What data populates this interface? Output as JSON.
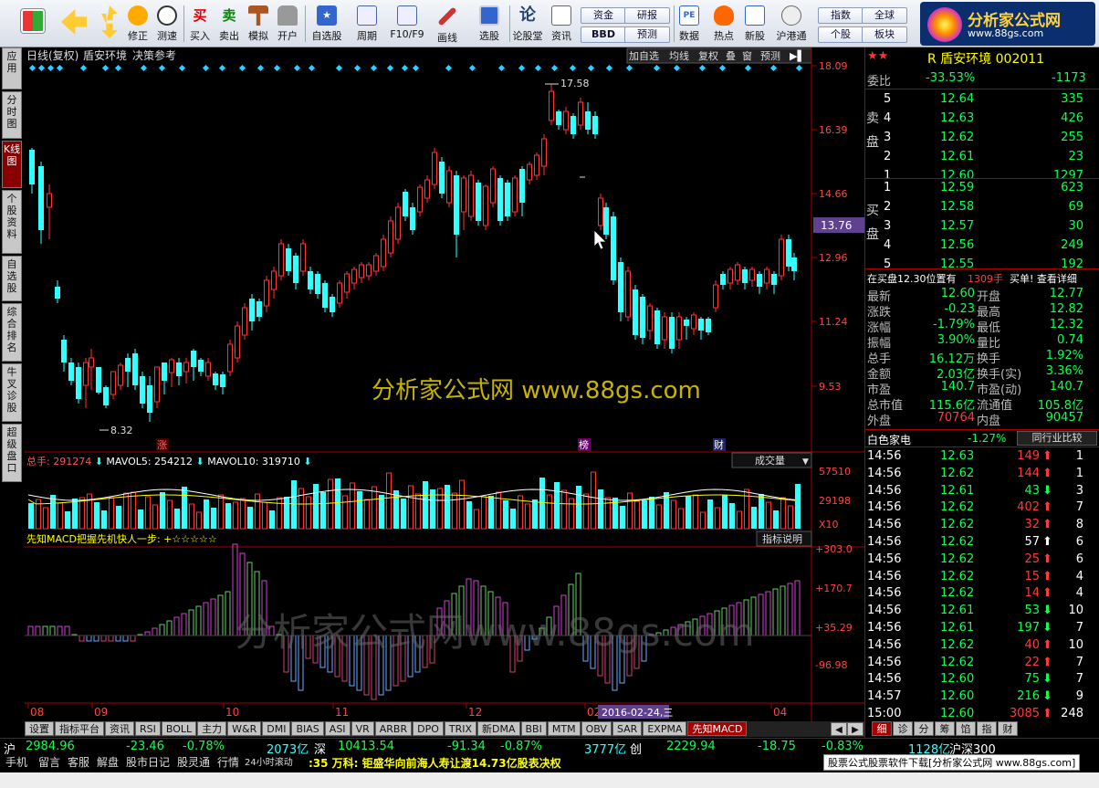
{
  "toolbar": {
    "buttons": [
      {
        "label": "",
        "icon": "grid-icon"
      },
      {
        "label": "",
        "icon": "back-arrow-icon"
      },
      {
        "label": "",
        "icon": "up-down-icon"
      },
      {
        "label": "修正",
        "icon": "clock-icon"
      },
      {
        "label": "测速",
        "icon": "speed-icon"
      },
      {
        "label": "买入",
        "icon": "buy-icon",
        "glyph": "买"
      },
      {
        "label": "卖出",
        "icon": "sell-icon",
        "glyph": "卖"
      },
      {
        "label": "模拟",
        "icon": "hammer-icon"
      },
      {
        "label": "开户",
        "icon": "lock-icon"
      },
      {
        "label": "自选股",
        "icon": "star-icon"
      },
      {
        "label": "周期",
        "icon": "period-icon"
      },
      {
        "label": "F10/F9",
        "icon": "f10-icon"
      },
      {
        "label": "画线",
        "icon": "pen-icon"
      },
      {
        "label": "选股",
        "icon": "select-icon"
      },
      {
        "label": "论股堂",
        "icon": "forum-icon",
        "glyph": "论"
      },
      {
        "label": "资讯",
        "icon": "news-icon"
      },
      {
        "label": "数据",
        "icon": "pe-icon",
        "glyph": "PE"
      },
      {
        "label": "热点",
        "icon": "fire-icon"
      },
      {
        "label": "新股",
        "icon": "newstock-icon"
      },
      {
        "label": "沪港通",
        "icon": "hk-icon"
      }
    ],
    "pills": [
      "资金",
      "BBD",
      "研报",
      "预测",
      "指数",
      "个股",
      "全球",
      "板块"
    ],
    "logo_text": "分析家公式网",
    "logo_url": "www.88gs.com"
  },
  "left_tabs": [
    "应用",
    "分时图",
    "K线图",
    "个股资料",
    "自选股",
    "综合排名",
    "牛叉诊股",
    "超级盘口"
  ],
  "chart": {
    "header": [
      "日线(复权)",
      "盾安环境",
      "决策参考"
    ],
    "header_buttons": [
      "加自选",
      "均线",
      "复权",
      "叠",
      "窗",
      "预测"
    ],
    "price_axis": [
      "18.09",
      "16.39",
      "14.66",
      "12.96",
      "11.24",
      "9.53"
    ],
    "current_price": "13.76",
    "high_label": "17.58",
    "low_label": "8.32",
    "event_tags": [
      "涨",
      "榜",
      "财"
    ],
    "watermark": "分析家公式网 www.88gs.com",
    "watermark2": "分析家公式网www.88gs.com",
    "vol_header": {
      "total": "总手: 291274",
      "ma5": "MAVOL5: 254212",
      "ma10": "MAVOL10: 319710"
    },
    "vol_button": "成交量",
    "vol_axis": [
      "57510",
      "29198",
      "X10"
    ],
    "macd_header": "先知MACD把握先机快人一步: +☆☆☆☆☆",
    "macd_button": "指标说明",
    "macd_axis": [
      "+303.0",
      "+170.7",
      "+35.29",
      "-96.98"
    ],
    "month_labels": [
      "08",
      "09",
      "10",
      "11",
      "12",
      "02",
      "04"
    ],
    "date_tag": "2016-02-24,三"
  },
  "quote": {
    "title": "R 盾安环境 002011",
    "weibi": {
      "label": "委比",
      "pct": "-33.53%",
      "diff": "-1173"
    },
    "sell_label": "卖盘",
    "buy_label": "买盘",
    "asks": [
      {
        "lv": "5",
        "price": "12.64",
        "vol": "335"
      },
      {
        "lv": "4",
        "price": "12.63",
        "vol": "426"
      },
      {
        "lv": "3",
        "price": "12.62",
        "vol": "255"
      },
      {
        "lv": "2",
        "price": "12.61",
        "vol": "23"
      },
      {
        "lv": "1",
        "price": "12.60",
        "vol": "1297"
      }
    ],
    "bids": [
      {
        "lv": "1",
        "price": "12.59",
        "vol": "623"
      },
      {
        "lv": "2",
        "price": "12.58",
        "vol": "69"
      },
      {
        "lv": "3",
        "price": "12.57",
        "vol": "30"
      },
      {
        "lv": "4",
        "price": "12.56",
        "vol": "249"
      },
      {
        "lv": "5",
        "price": "12.55",
        "vol": "192"
      }
    ],
    "position_line": {
      "text": "在买盘12.30位置有",
      "qty": "1309手",
      "tail": "买单! 查看详细"
    },
    "stats": [
      {
        "l1": "最新",
        "v1": "12.60",
        "l2": "开盘",
        "v2": "12.77"
      },
      {
        "l1": "涨跌",
        "v1": "-0.23",
        "l2": "最高",
        "v2": "12.82"
      },
      {
        "l1": "涨幅",
        "v1": "-1.79%",
        "l2": "最低",
        "v2": "12.32"
      },
      {
        "l1": "振幅",
        "v1": "3.90%",
        "l2": "量比",
        "v2": "0.74"
      },
      {
        "l1": "总手",
        "v1": "16.12万",
        "l2": "换手",
        "v2": "1.92%"
      },
      {
        "l1": "金额",
        "v1": "2.03亿",
        "l2": "换手(实)",
        "v2": "3.36%"
      },
      {
        "l1": "市盈",
        "v1": "140.7",
        "l2": "市盈(动)",
        "v2": "140.7"
      },
      {
        "l1": "总市值",
        "v1": "115.6亿",
        "l2": "流通值",
        "v2": "105.8亿"
      },
      {
        "l1": "外盘",
        "v1": "70764",
        "l2": "内盘",
        "v2": "90457"
      }
    ],
    "sector": {
      "name": "白色家电",
      "pct": "-1.27%",
      "button": "同行业比较"
    },
    "ticks": [
      {
        "t": "14:56",
        "p": "12.63",
        "v": "149",
        "d": "up",
        "n": "1"
      },
      {
        "t": "14:56",
        "p": "12.62",
        "v": "144",
        "d": "up",
        "n": "1"
      },
      {
        "t": "14:56",
        "p": "12.61",
        "v": "43",
        "d": "down",
        "n": "3"
      },
      {
        "t": "14:56",
        "p": "12.62",
        "v": "402",
        "d": "up",
        "n": "7"
      },
      {
        "t": "14:56",
        "p": "12.62",
        "v": "32",
        "d": "up",
        "n": "8"
      },
      {
        "t": "14:56",
        "p": "12.62",
        "v": "57",
        "d": "flat",
        "n": "6"
      },
      {
        "t": "14:56",
        "p": "12.62",
        "v": "25",
        "d": "up",
        "n": "6"
      },
      {
        "t": "14:56",
        "p": "12.62",
        "v": "15",
        "d": "up",
        "n": "4"
      },
      {
        "t": "14:56",
        "p": "12.62",
        "v": "14",
        "d": "up",
        "n": "4"
      },
      {
        "t": "14:56",
        "p": "12.61",
        "v": "53",
        "d": "down",
        "n": "10"
      },
      {
        "t": "14:56",
        "p": "12.61",
        "v": "197",
        "d": "down",
        "n": "7"
      },
      {
        "t": "14:56",
        "p": "12.62",
        "v": "40",
        "d": "up",
        "n": "10"
      },
      {
        "t": "14:56",
        "p": "12.62",
        "v": "22",
        "d": "up",
        "n": "7"
      },
      {
        "t": "14:56",
        "p": "12.60",
        "v": "75",
        "d": "down",
        "n": "7"
      },
      {
        "t": "14:57",
        "p": "12.60",
        "v": "216",
        "d": "down",
        "n": "9"
      },
      {
        "t": "15:00",
        "p": "12.60",
        "v": "3085",
        "d": "up",
        "n": "248"
      }
    ]
  },
  "bottom_tabs": [
    "设置",
    "指标平台",
    "资讯",
    "RSI",
    "BOLL",
    "主力",
    "W&R",
    "DMI",
    "BIAS",
    "ASI",
    "VR",
    "ARBR",
    "DPO",
    "TRIX",
    "新DMA",
    "BBI",
    "MTM",
    "OBV",
    "SAR",
    "EXPMA",
    "先知MACD"
  ],
  "right_tabs": [
    "细",
    "诊",
    "分",
    "筹",
    "馅",
    "指",
    "财"
  ],
  "status": {
    "sh_label": "沪",
    "sh_idx": "2984.96",
    "sh_chg": "-23.46",
    "sh_pct": "-0.78%",
    "sh_amt": "2073亿",
    "sz_label": "深",
    "sz_idx": "10413.54",
    "sz_chg": "-91.34",
    "sz_pct": "-0.87%",
    "sz_amt": "3777亿",
    "cy_label": "创",
    "cy_idx": "2229.94",
    "cy_chg": "-18.75",
    "cy_pct": "-0.83%",
    "cy_amt": "1128亿",
    "hgt": "沪深300"
  },
  "status2": {
    "buttons": [
      "手机",
      "留言",
      "客服",
      "解盘",
      "股市日记",
      "股灵通",
      "行情"
    ],
    "scroll_label": "24小时滚动",
    "news": ":35 万科: 钜盛华向前海人寿让渡14.73亿股表决权",
    "ad": "股票公式股票软件下载[分析家公式网 www.88gs.com]"
  }
}
